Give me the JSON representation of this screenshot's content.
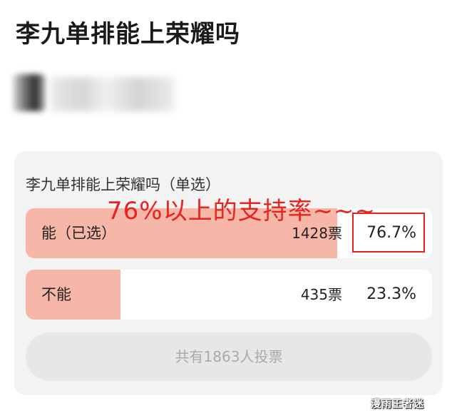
{
  "page": {
    "title": "李九单排能上荣耀吗"
  },
  "poll": {
    "question": "李九单排能上荣耀吗（单选）",
    "options": [
      {
        "label": "能（已选）",
        "votes": "1428票",
        "percent": "76.7%",
        "share": 76.7,
        "selected": true
      },
      {
        "label": "不能",
        "votes": "435票",
        "percent": "23.3%",
        "share": 23.3,
        "selected": false
      }
    ],
    "total_label": "共有1863人投票"
  },
  "annotation": {
    "text": "76%以上的支持率~~~",
    "color": "#e8231e"
  },
  "watermark": {
    "text": "漫雨王者迷"
  },
  "colors": {
    "fill": "#f7b7a8",
    "card_bg": "#f3f3f3",
    "highlight": "#e8231e"
  }
}
